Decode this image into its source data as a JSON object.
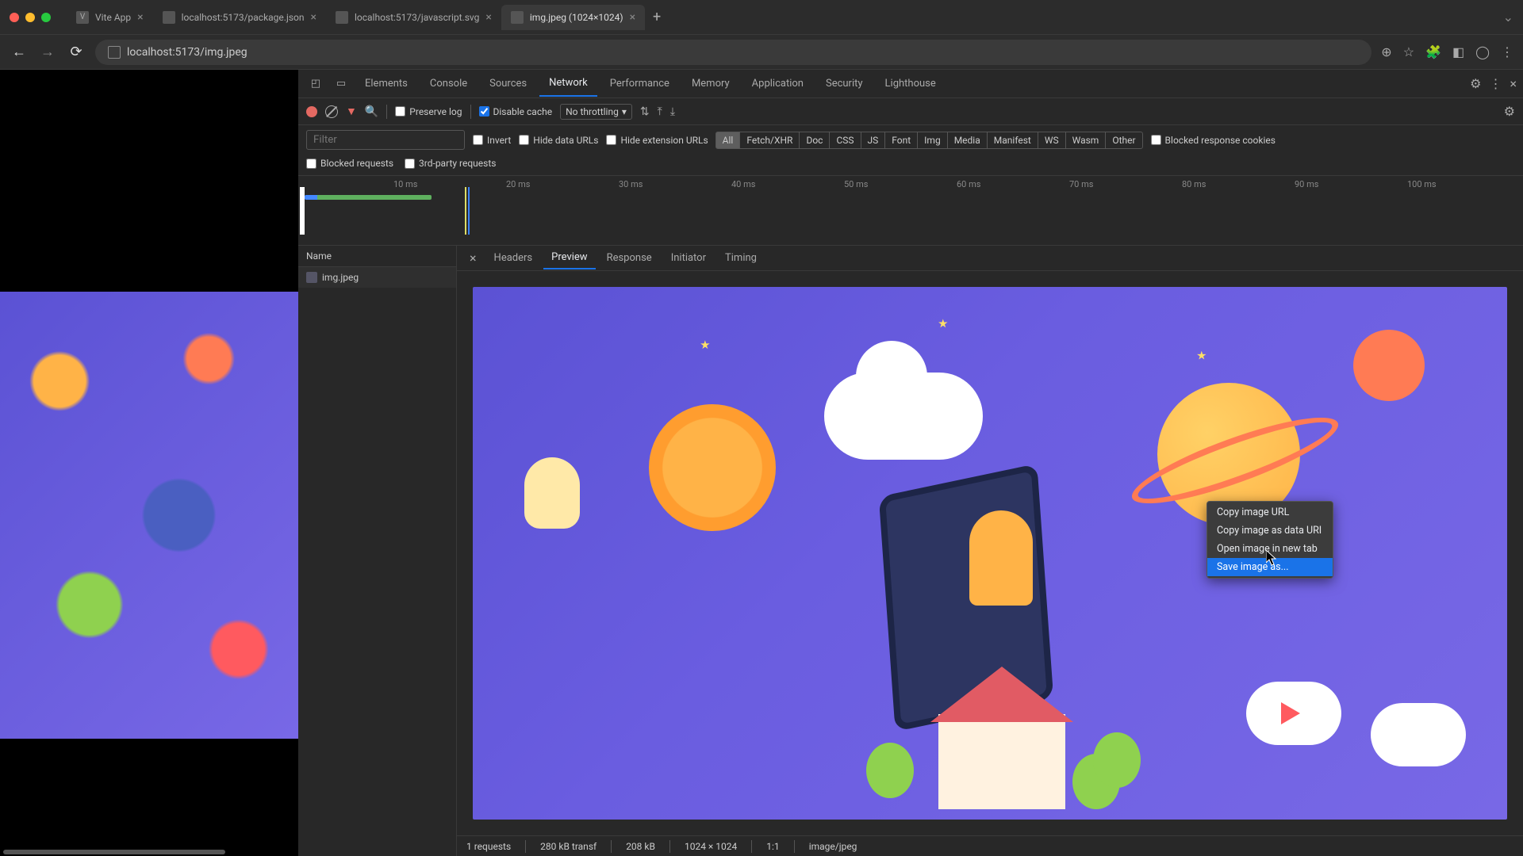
{
  "browser": {
    "tabs": [
      {
        "label": "Vite App"
      },
      {
        "label": "localhost:5173/package.json"
      },
      {
        "label": "localhost:5173/javascript.svg"
      },
      {
        "label": "img.jpeg (1024×1024)"
      }
    ],
    "url": "localhost:5173/img.jpeg"
  },
  "devtools": {
    "panels": [
      "Elements",
      "Console",
      "Sources",
      "Network",
      "Performance",
      "Memory",
      "Application",
      "Security",
      "Lighthouse"
    ],
    "active_panel": "Network"
  },
  "network": {
    "toolbar": {
      "preserve_log": "Preserve log",
      "disable_cache": "Disable cache",
      "throttling": "No throttling"
    },
    "filter": {
      "placeholder": "Filter",
      "invert": "Invert",
      "hide_data_urls": "Hide data URLs",
      "hide_ext_urls": "Hide extension URLs",
      "types": [
        "All",
        "Fetch/XHR",
        "Doc",
        "CSS",
        "JS",
        "Font",
        "Img",
        "Media",
        "Manifest",
        "WS",
        "Wasm",
        "Other"
      ],
      "blocked_cookies": "Blocked response cookies",
      "blocked_requests": "Blocked requests",
      "third_party": "3rd-party requests"
    },
    "timeline_ticks": [
      "10 ms",
      "20 ms",
      "30 ms",
      "40 ms",
      "50 ms",
      "60 ms",
      "70 ms",
      "80 ms",
      "90 ms",
      "100 ms"
    ],
    "list_header": "Name",
    "rows": [
      {
        "name": "img.jpeg"
      }
    ],
    "detail_tabs": [
      "Headers",
      "Preview",
      "Response",
      "Initiator",
      "Timing"
    ],
    "status": {
      "requests": "1 requests",
      "transfer": "280 kB transf",
      "size": "208 kB",
      "dims": "1024 × 1024",
      "ratio": "1:1",
      "mime": "image/jpeg"
    }
  },
  "context_menu": {
    "items": [
      "Copy image URL",
      "Copy image as data URI",
      "Open image in new tab",
      "Save image as..."
    ],
    "hovered_index": 3
  }
}
